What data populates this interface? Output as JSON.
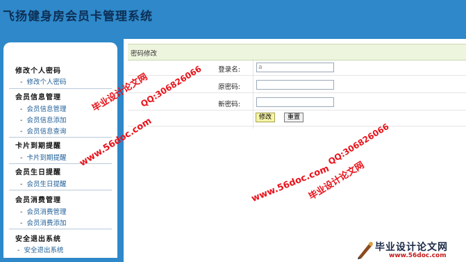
{
  "app": {
    "title": "飞扬健身房会员卡管理系统"
  },
  "sidebar": {
    "groups": [
      {
        "title": "修改个人密码",
        "items": [
          "修改个人密码"
        ]
      },
      {
        "title": "会员信息管理",
        "items": [
          "会员信息管理",
          "会员信息添加",
          "会员信息查询"
        ]
      },
      {
        "title": "卡片到期提醒",
        "items": [
          "卡片到期提醒"
        ]
      },
      {
        "title": "会员生日提醒",
        "items": [
          "会员生日提醒"
        ]
      },
      {
        "title": "会员消费管理",
        "items": [
          "会员消费管理",
          "会员消费添加"
        ]
      },
      {
        "title": "安全退出系统",
        "items": [
          "安全退出系统"
        ]
      }
    ],
    "bullet": "-"
  },
  "main": {
    "panel_title": "密码修改",
    "form": {
      "username_label": "登录名:",
      "username_value": "a",
      "old_password_label": "原密码:",
      "old_password_value": "",
      "new_password_label": "新密码:",
      "new_password_value": "",
      "modify_button": "修改",
      "reset_button": "重置"
    }
  },
  "watermarks": {
    "brand": "毕业设计论文网",
    "site": "www.56doc.com",
    "qq": "QQ:306826066",
    "logo_url": "www.56doc.com"
  },
  "colors": {
    "header_bg": "#2e88c9",
    "title_text": "#0d2f55",
    "panel_head_bg": "#eef5de",
    "link": "#1f5e97",
    "watermark_red": "#e8121a"
  }
}
